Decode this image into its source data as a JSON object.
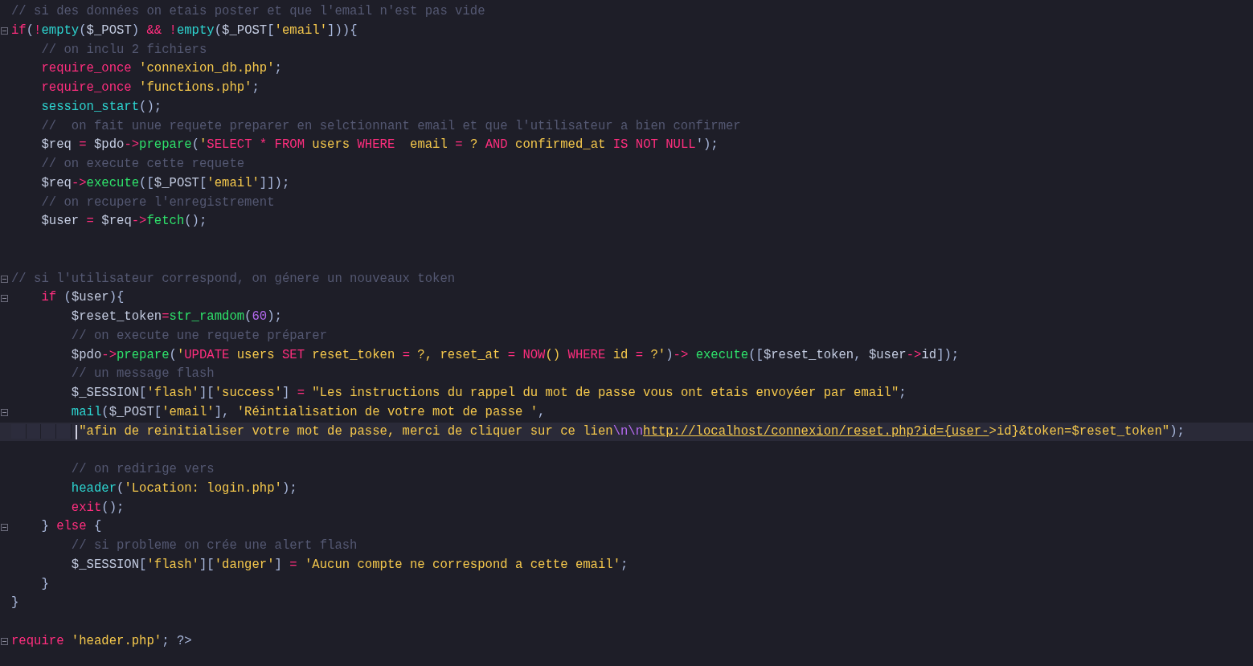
{
  "editor": {
    "lines": [
      {
        "kind": "code",
        "fold": false,
        "current": false,
        "tokens": [
          {
            "kind": "comment",
            "text": "// si des données on etais poster et que l'email n'est pas vide"
          }
        ]
      },
      {
        "kind": "code",
        "fold": true,
        "current": false,
        "tokens": [
          {
            "kind": "keyword",
            "text": "if"
          },
          {
            "kind": "punct",
            "text": "("
          },
          {
            "kind": "op",
            "text": "!"
          },
          {
            "kind": "func",
            "text": "empty"
          },
          {
            "kind": "punct",
            "text": "("
          },
          {
            "kind": "var",
            "text": "$_POST"
          },
          {
            "kind": "punct",
            "text": ")"
          },
          {
            "kind": "op",
            "text": " && !"
          },
          {
            "kind": "func",
            "text": "empty"
          },
          {
            "kind": "punct",
            "text": "("
          },
          {
            "kind": "var",
            "text": "$_POST"
          },
          {
            "kind": "punct",
            "text": "["
          },
          {
            "kind": "string",
            "text": "'email'"
          },
          {
            "kind": "punct",
            "text": "])){"
          }
        ]
      },
      {
        "kind": "code",
        "fold": false,
        "current": false,
        "tokens": [
          {
            "kind": "comment",
            "text": "    // on inclu 2 fichiers"
          }
        ]
      },
      {
        "kind": "code",
        "fold": false,
        "current": false,
        "tokens": [
          {
            "kind": "keyword",
            "text": "    require_once"
          },
          {
            "kind": "string",
            "text": " 'connexion_db.php'"
          },
          {
            "kind": "punct",
            "text": ";"
          }
        ]
      },
      {
        "kind": "code",
        "fold": false,
        "current": false,
        "tokens": [
          {
            "kind": "keyword",
            "text": "    require_once"
          },
          {
            "kind": "string",
            "text": " 'functions.php'"
          },
          {
            "kind": "punct",
            "text": ";"
          }
        ]
      },
      {
        "kind": "code",
        "fold": false,
        "current": false,
        "tokens": [
          {
            "kind": "func",
            "text": "    session_start"
          },
          {
            "kind": "punct",
            "text": "();"
          }
        ]
      },
      {
        "kind": "code",
        "fold": false,
        "current": false,
        "tokens": [
          {
            "kind": "comment",
            "text": "    //  on fait unue requete preparer en selctionnant email et que l'utilisateur a bien confirmer"
          }
        ]
      },
      {
        "kind": "code",
        "fold": false,
        "current": false,
        "tokens": [
          {
            "kind": "var",
            "text": "    $req"
          },
          {
            "kind": "op",
            "text": " = "
          },
          {
            "kind": "var",
            "text": "$pdo"
          },
          {
            "kind": "op",
            "text": "->"
          },
          {
            "kind": "method",
            "text": "prepare"
          },
          {
            "kind": "punct",
            "text": "("
          },
          {
            "kind": "string",
            "text": "'"
          },
          {
            "kind": "sqlkw",
            "text": "SELECT * FROM"
          },
          {
            "kind": "string",
            "text": " users "
          },
          {
            "kind": "sqlkw",
            "text": "WHERE"
          },
          {
            "kind": "string",
            "text": "  email "
          },
          {
            "kind": "op",
            "text": "="
          },
          {
            "kind": "string",
            "text": " ? "
          },
          {
            "kind": "sqlkw",
            "text": "AND"
          },
          {
            "kind": "string",
            "text": " confirmed_at "
          },
          {
            "kind": "sqlkw",
            "text": "IS NOT NULL"
          },
          {
            "kind": "punct",
            "text": "');"
          }
        ]
      },
      {
        "kind": "code",
        "fold": false,
        "current": false,
        "tokens": [
          {
            "kind": "comment",
            "text": "    // on execute cette requete"
          }
        ]
      },
      {
        "kind": "code",
        "fold": false,
        "current": false,
        "tokens": [
          {
            "kind": "var",
            "text": "    $req"
          },
          {
            "kind": "op",
            "text": "->"
          },
          {
            "kind": "method",
            "text": "execute"
          },
          {
            "kind": "punct",
            "text": "(["
          },
          {
            "kind": "var",
            "text": "$_POST"
          },
          {
            "kind": "punct",
            "text": "["
          },
          {
            "kind": "string",
            "text": "'email'"
          },
          {
            "kind": "punct",
            "text": "]]);"
          }
        ]
      },
      {
        "kind": "code",
        "fold": false,
        "current": false,
        "tokens": [
          {
            "kind": "comment",
            "text": "    // on recupere l'enregistrement"
          }
        ]
      },
      {
        "kind": "code",
        "fold": false,
        "current": false,
        "tokens": [
          {
            "kind": "var",
            "text": "    $user"
          },
          {
            "kind": "op",
            "text": " = "
          },
          {
            "kind": "var",
            "text": "$req"
          },
          {
            "kind": "op",
            "text": "->"
          },
          {
            "kind": "method",
            "text": "fetch"
          },
          {
            "kind": "punct",
            "text": "();"
          }
        ]
      },
      {
        "kind": "blank",
        "fold": false,
        "current": false
      },
      {
        "kind": "blank",
        "fold": false,
        "current": false
      },
      {
        "kind": "code",
        "fold": true,
        "current": false,
        "tokens": [
          {
            "kind": "comment",
            "text": "// si l'utilisateur correspond, on génere un nouveaux token"
          }
        ]
      },
      {
        "kind": "code",
        "fold": true,
        "current": false,
        "tokens": [
          {
            "kind": "keyword",
            "text": "    if"
          },
          {
            "kind": "punct",
            "text": " ("
          },
          {
            "kind": "var",
            "text": "$user"
          },
          {
            "kind": "punct",
            "text": "){"
          }
        ]
      },
      {
        "kind": "code",
        "fold": false,
        "current": false,
        "tokens": [
          {
            "kind": "var",
            "text": "        $reset_token"
          },
          {
            "kind": "op",
            "text": "="
          },
          {
            "kind": "method",
            "text": "str_ramdom"
          },
          {
            "kind": "punct",
            "text": "("
          },
          {
            "kind": "number",
            "text": "60"
          },
          {
            "kind": "punct",
            "text": ");"
          }
        ]
      },
      {
        "kind": "code",
        "fold": false,
        "current": false,
        "tokens": [
          {
            "kind": "comment",
            "text": "        // on execute une requete préparer"
          }
        ]
      },
      {
        "kind": "code",
        "fold": false,
        "current": false,
        "tokens": [
          {
            "kind": "var",
            "text": "        $pdo"
          },
          {
            "kind": "op",
            "text": "->"
          },
          {
            "kind": "method",
            "text": "prepare"
          },
          {
            "kind": "punct",
            "text": "("
          },
          {
            "kind": "string",
            "text": "'"
          },
          {
            "kind": "sqlkw",
            "text": "UPDATE"
          },
          {
            "kind": "string",
            "text": " users "
          },
          {
            "kind": "sqlkw",
            "text": "SET"
          },
          {
            "kind": "string",
            "text": " reset_token "
          },
          {
            "kind": "op",
            "text": "="
          },
          {
            "kind": "string",
            "text": " ?, reset_at "
          },
          {
            "kind": "op",
            "text": "="
          },
          {
            "kind": "sqlkw",
            "text": " NOW"
          },
          {
            "kind": "string",
            "text": "() "
          },
          {
            "kind": "sqlkw",
            "text": "WHERE"
          },
          {
            "kind": "string",
            "text": " id "
          },
          {
            "kind": "op",
            "text": "="
          },
          {
            "kind": "string",
            "text": " ?'"
          },
          {
            "kind": "punct",
            "text": ")"
          },
          {
            "kind": "op",
            "text": "->"
          },
          {
            "kind": "method",
            "text": " execute"
          },
          {
            "kind": "punct",
            "text": "(["
          },
          {
            "kind": "var",
            "text": "$reset_token"
          },
          {
            "kind": "punct",
            "text": ","
          },
          {
            "kind": "var",
            "text": " $user"
          },
          {
            "kind": "op",
            "text": "->"
          },
          {
            "kind": "var",
            "text": "id"
          },
          {
            "kind": "punct",
            "text": "]);"
          }
        ]
      },
      {
        "kind": "code",
        "fold": false,
        "current": false,
        "tokens": [
          {
            "kind": "comment",
            "text": "        // un message flash"
          }
        ]
      },
      {
        "kind": "code",
        "fold": false,
        "current": false,
        "tokens": [
          {
            "kind": "var",
            "text": "        $_SESSION"
          },
          {
            "kind": "punct",
            "text": "["
          },
          {
            "kind": "string",
            "text": "'flash'"
          },
          {
            "kind": "punct",
            "text": "]["
          },
          {
            "kind": "string",
            "text": "'success'"
          },
          {
            "kind": "punct",
            "text": "]"
          },
          {
            "kind": "op",
            "text": " = "
          },
          {
            "kind": "string",
            "text": "\"Les instructions du rappel du mot de passe vous ont etais envoyéer par email\""
          },
          {
            "kind": "punct",
            "text": ";"
          }
        ]
      },
      {
        "kind": "code",
        "fold": true,
        "current": false,
        "tokens": [
          {
            "kind": "func",
            "text": "        mail"
          },
          {
            "kind": "punct",
            "text": "("
          },
          {
            "kind": "var",
            "text": "$_POST"
          },
          {
            "kind": "punct",
            "text": "["
          },
          {
            "kind": "string",
            "text": "'email'"
          },
          {
            "kind": "punct",
            "text": "],"
          },
          {
            "kind": "string",
            "text": " 'Réintialisation de votre mot de passe '"
          },
          {
            "kind": "punct",
            "text": ","
          }
        ]
      },
      {
        "kind": "code",
        "fold": false,
        "current": true,
        "tokens": [
          {
            "kind": "string",
            "text": "         \"afin de reinitialiser votre mot de passe, merci de cliquer sur ce lien"
          },
          {
            "kind": "escape",
            "text": "\\n\\n"
          },
          {
            "kind": "link",
            "text": "http://localhost/connexion/reset.php?id={user-"
          },
          {
            "kind": "string",
            "text": ">id}&token=$reset_token\""
          },
          {
            "kind": "punct",
            "text": ");"
          }
        ]
      },
      {
        "kind": "blank",
        "fold": false,
        "current": false
      },
      {
        "kind": "code",
        "fold": false,
        "current": false,
        "tokens": [
          {
            "kind": "comment",
            "text": "        // on redirige vers"
          }
        ]
      },
      {
        "kind": "code",
        "fold": false,
        "current": false,
        "tokens": [
          {
            "kind": "func",
            "text": "        header"
          },
          {
            "kind": "punct",
            "text": "("
          },
          {
            "kind": "string",
            "text": "'Location: login.php'"
          },
          {
            "kind": "punct",
            "text": ");"
          }
        ]
      },
      {
        "kind": "code",
        "fold": false,
        "current": false,
        "tokens": [
          {
            "kind": "keyword",
            "text": "        exit"
          },
          {
            "kind": "punct",
            "text": "();"
          }
        ]
      },
      {
        "kind": "code",
        "fold": true,
        "current": false,
        "tokens": [
          {
            "kind": "punct",
            "text": "    }"
          },
          {
            "kind": "keyword",
            "text": " else"
          },
          {
            "kind": "punct",
            "text": " {"
          }
        ]
      },
      {
        "kind": "code",
        "fold": false,
        "current": false,
        "tokens": [
          {
            "kind": "comment",
            "text": "        // si probleme on crée une alert flash"
          }
        ]
      },
      {
        "kind": "code",
        "fold": false,
        "current": false,
        "tokens": [
          {
            "kind": "var",
            "text": "        $_SESSION"
          },
          {
            "kind": "punct",
            "text": "["
          },
          {
            "kind": "string",
            "text": "'flash'"
          },
          {
            "kind": "punct",
            "text": "]["
          },
          {
            "kind": "string",
            "text": "'danger'"
          },
          {
            "kind": "punct",
            "text": "]"
          },
          {
            "kind": "op",
            "text": " = "
          },
          {
            "kind": "string",
            "text": "'Aucun compte ne correspond a cette email'"
          },
          {
            "kind": "punct",
            "text": ";"
          }
        ]
      },
      {
        "kind": "code",
        "fold": false,
        "current": false,
        "tokens": [
          {
            "kind": "punct",
            "text": "    }"
          }
        ]
      },
      {
        "kind": "code",
        "fold": false,
        "current": false,
        "tokens": [
          {
            "kind": "punct",
            "text": "}"
          }
        ]
      },
      {
        "kind": "blank",
        "fold": false,
        "current": false
      },
      {
        "kind": "code",
        "fold": true,
        "current": false,
        "tokens": [
          {
            "kind": "keyword",
            "text": "require"
          },
          {
            "kind": "string",
            "text": " 'header.php'"
          },
          {
            "kind": "punct",
            "text": "; ?>"
          }
        ]
      }
    ]
  }
}
